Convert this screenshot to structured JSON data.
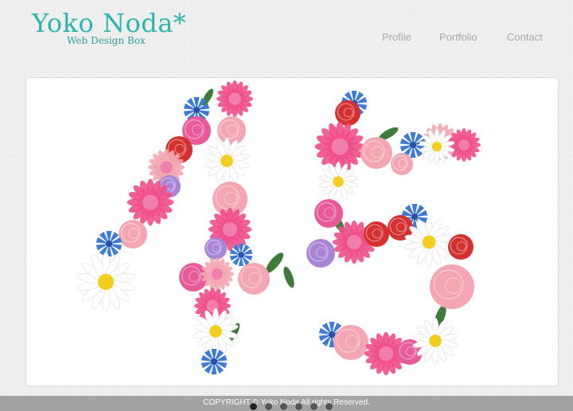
{
  "header": {
    "brand_name": "Yoko Noda*",
    "brand_tagline": "Web Design Box"
  },
  "nav": {
    "items": [
      {
        "label": "Profile"
      },
      {
        "label": "Portfolio"
      },
      {
        "label": "Contact"
      }
    ]
  },
  "hero": {
    "image_alt": "45",
    "colors": {
      "rose_pink": "#e85a9a",
      "rose_light": "#f4a7b3",
      "dahlia": "#ef4f8a",
      "cornflower": "#3d7bd6",
      "daisy_petal": "#ffffff",
      "daisy_center": "#f2cf1e",
      "red_flower": "#d2312f",
      "lavender": "#a985d6",
      "leaf": "#3e7a3a"
    }
  },
  "slider": {
    "count": 6,
    "active_index": 0
  },
  "footer": {
    "copyright": "COPYRIGHT © Yoko Noda All rights Reserved."
  }
}
